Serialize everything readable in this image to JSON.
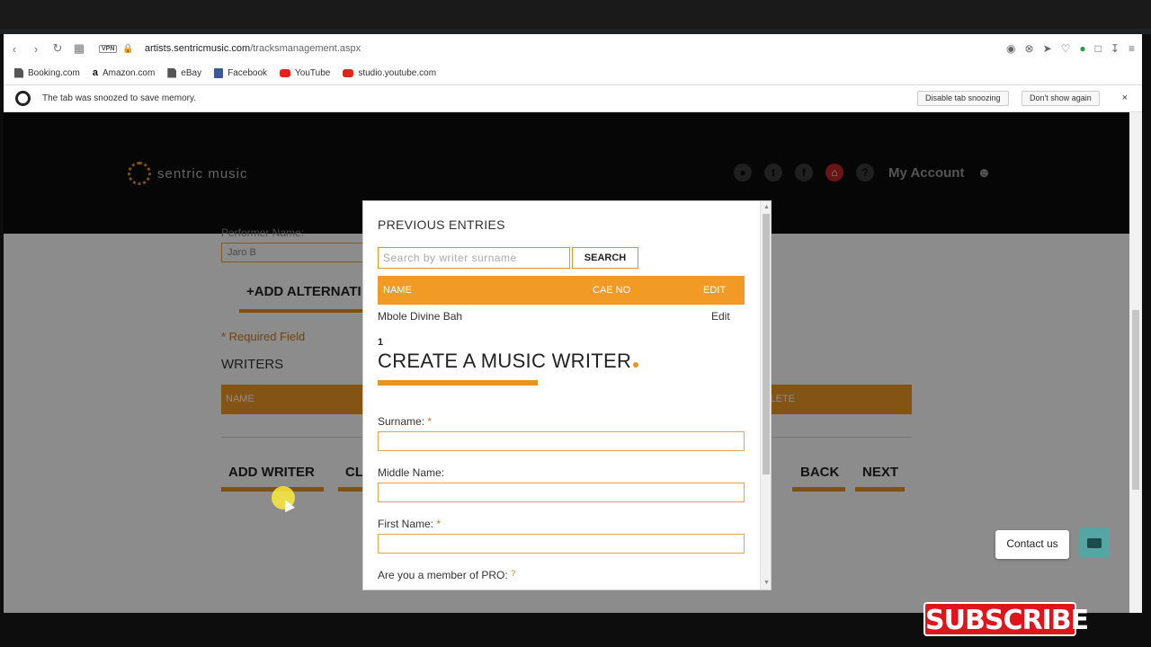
{
  "browser": {
    "url_domain": "artists.sentricmusic.com",
    "url_path": "/tracksmanagement.aspx",
    "vpn_label": "VPN",
    "bookmarks": [
      "Booking.com",
      "Amazon.com",
      "eBay",
      "Facebook",
      "YouTube",
      "studio.youtube.com"
    ],
    "snooze_message": "The tab was snoozed to save memory.",
    "snooze_disable": "Disable tab snoozing",
    "snooze_dont_show": "Don't show again",
    "close_glyph": "×"
  },
  "site": {
    "logo_text": "sentric music",
    "account_label": "My Account"
  },
  "background_form": {
    "performer_label": "Performer Name:",
    "performer_value": "Jaro B",
    "add_alternative": "+ADD ALTERNATI",
    "required_note": "* Required Field",
    "writers_heading": "WRITERS",
    "table_name": "NAME",
    "table_delete": "LETE",
    "btn_add_writer": "ADD WRITER",
    "btn_clear": "CL",
    "btn_back": "BACK",
    "btn_next": "NEXT"
  },
  "modal": {
    "previous_title": "PREVIOUS ENTRIES",
    "search_placeholder": "Search by writer surname",
    "search_button": "SEARCH",
    "columns": {
      "name": "NAME",
      "cae": "CAE NO",
      "edit": "EDIT"
    },
    "rows": [
      {
        "name": "Mbole Divine Bah",
        "cae": "",
        "edit": "Edit"
      }
    ],
    "page_number": "1",
    "create_title": "CREATE A MUSIC WRITER",
    "fields": {
      "surname": "Surname:",
      "middle": "Middle Name:",
      "first": "First Name:",
      "pro": "Are you a member of PRO:"
    },
    "required_mark": "*",
    "help_mark": "?"
  },
  "widgets": {
    "contact_us": "Contact us",
    "subscribe": "SUBSCRIBE"
  },
  "colors": {
    "accent": "#f19a25",
    "header_bg": "#0b0b0b",
    "chat": "#55a5a2",
    "subscribe": "#e0151c"
  }
}
